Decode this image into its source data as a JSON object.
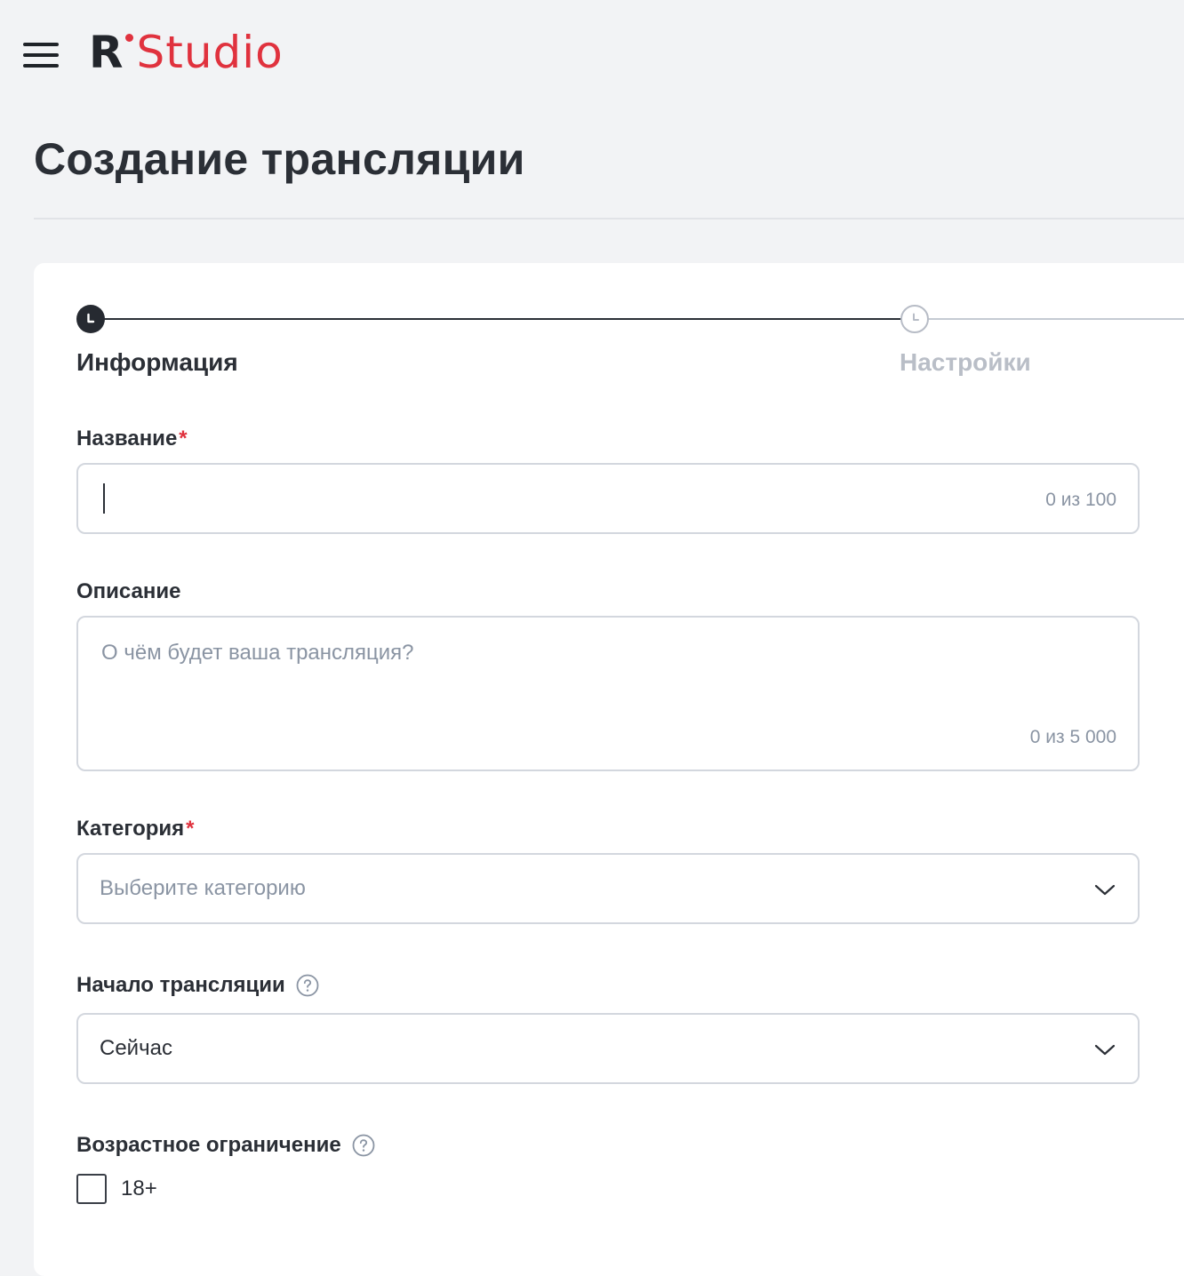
{
  "header": {
    "logo_r": "R",
    "logo_studio": "Studio",
    "page_title": "Создание трансляции"
  },
  "stepper": {
    "steps": [
      {
        "label": "Информация",
        "state": "active"
      },
      {
        "label": "Настройки",
        "state": "inactive"
      }
    ]
  },
  "form": {
    "name": {
      "label": "Название",
      "required_mark": "*",
      "value": "",
      "counter": "0 из 100"
    },
    "description": {
      "label": "Описание",
      "placeholder": "О чём будет ваша трансляция?",
      "counter": "0 из 5 000"
    },
    "category": {
      "label": "Категория",
      "required_mark": "*",
      "placeholder": "Выберите категорию"
    },
    "start": {
      "label": "Начало трансляции",
      "value": "Сейчас"
    },
    "age_restriction": {
      "label": "Возрастное ограничение",
      "checkbox_label": "18+",
      "checked": false
    }
  },
  "colors": {
    "accent": "#e0323e",
    "background": "#f2f3f5",
    "text": "#2b2f36",
    "muted": "#8a94a3",
    "border": "#d3d7de"
  },
  "icons": {
    "menu": "hamburger-menu-icon",
    "step": "clock-icon",
    "help": "question-circle-icon",
    "dropdown": "chevron-down-icon"
  }
}
